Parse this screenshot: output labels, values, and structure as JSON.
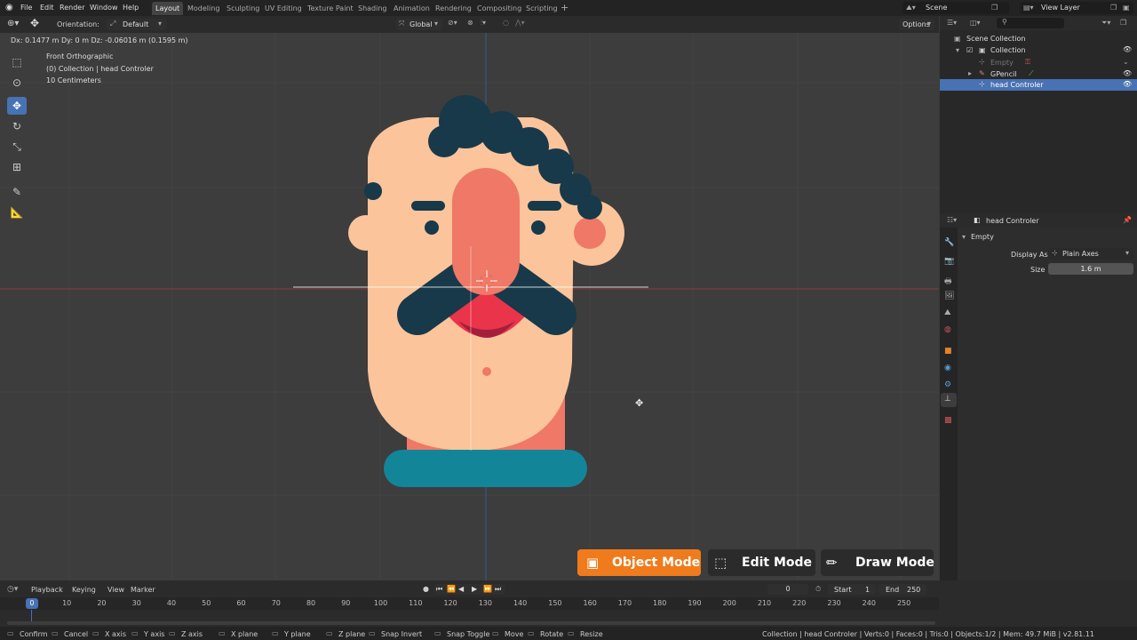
{
  "topbar": {
    "menu": [
      "File",
      "Edit",
      "Render",
      "Window",
      "Help"
    ],
    "workspaces": [
      "Layout",
      "Modeling",
      "Sculpting",
      "UV Editing",
      "Texture Paint",
      "Shading",
      "Animation",
      "Rendering",
      "Compositing",
      "Scripting"
    ],
    "active_workspace": "Layout",
    "add_tab": "+",
    "scene": "Scene",
    "view_layer": "View Layer"
  },
  "header": {
    "orientation_label": "Orientation:",
    "orientation_value": "Default",
    "transform_space": "Global",
    "options": "Options"
  },
  "viewport": {
    "transform_info": "Dx: 0.1477 m   Dy: 0 m   Dz: -0.06016 m (0.1595 m)",
    "view_name": "Front Orthographic",
    "collection_info": "(0) Collection | head Controler",
    "scale": "10 Centimeters"
  },
  "outliner": {
    "root": "Scene Collection",
    "collection": "Collection",
    "items": [
      "Empty",
      "GPencil",
      "head Controler"
    ]
  },
  "properties": {
    "object_name": "head Controler",
    "panel": "Empty",
    "display_as_label": "Display As",
    "display_as_value": "Plain Axes",
    "size_label": "Size",
    "size_value": "1.6 m"
  },
  "modes": {
    "object": "Object Mode",
    "edit": "Edit Mode",
    "draw": "Draw Mode"
  },
  "timeline": {
    "menus": [
      "Playback",
      "Keying",
      "View",
      "Marker"
    ],
    "current_frame": "0",
    "start_label": "Start",
    "start_value": "1",
    "end_label": "End",
    "end_value": "250",
    "ruler": [
      "0",
      "10",
      "20",
      "30",
      "40",
      "50",
      "60",
      "70",
      "80",
      "90",
      "100",
      "110",
      "120",
      "130",
      "140",
      "150",
      "160",
      "170",
      "180",
      "190",
      "200",
      "210",
      "220",
      "230",
      "240",
      "250"
    ]
  },
  "status": {
    "hints": [
      "Confirm",
      "Cancel",
      "X axis",
      "Y axis",
      "Z axis",
      "X plane",
      "Y plane",
      "Z plane",
      "Snap Invert",
      "Snap Toggle",
      "Move",
      "Rotate",
      "Resize"
    ],
    "stats": "Collection | head Controler | Verts:0 | Faces:0 | Tris:0 | Objects:1/2 | Mem: 49.7 MiB | v2.81.11"
  },
  "colors": {
    "skin": "#fbc49a",
    "hair": "#17394a",
    "nose": "#ef7866",
    "mouth": "#e9344a",
    "collar": "#138599",
    "object_mode": "#f07b1c",
    "selection": "#4772b3"
  }
}
